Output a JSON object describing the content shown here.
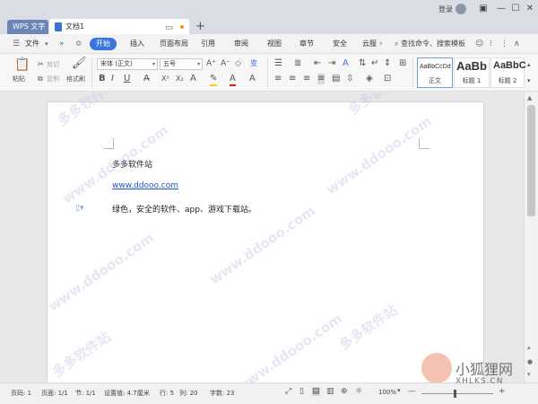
{
  "titlebar": {
    "app_tab": "WPS 文字",
    "doc_tab": "文档1",
    "new_tab": "+",
    "login": "登录",
    "minimize": "—",
    "maximize": "☐",
    "close": "✕"
  },
  "menu": {
    "file": "文件",
    "active": "开始",
    "items": [
      "插入",
      "页面布局",
      "引用",
      "审阅",
      "视图",
      "章节",
      "安全",
      "云服"
    ],
    "search": "查找命令、搜索模板"
  },
  "ribbon": {
    "paste": "粘贴",
    "cut": "剪切",
    "copy": "复制",
    "format_painter": "格式刷",
    "font": "宋体 (正文)",
    "size": "五号",
    "styles": [
      {
        "sample": "AaBbCcDd",
        "name": "正文"
      },
      {
        "sample": "AaBb",
        "name": "标题 1"
      },
      {
        "sample": "AaBbC",
        "name": "标题 2"
      }
    ],
    "colors": {
      "accent": "#3a74db",
      "font_color": "#e02020",
      "highlight": "#f5d020"
    }
  },
  "document": {
    "line1": "多多软件站",
    "line2": "www.ddooo.com",
    "line3": "绿色，安全的软件、app、游戏下载站。",
    "watermark_cn": "多多软件站",
    "watermark_url": "www.ddooo.com"
  },
  "statusbar": {
    "page": "页码: 1",
    "pages": "页面: 1/1",
    "section": "节: 1/1",
    "setting": "设置值: 4.7厘米",
    "row": "行: 5",
    "col": "列: 20",
    "words": "字数: 23",
    "zoom": "100%",
    "zoom_minus": "—",
    "zoom_plus": "+"
  },
  "branding": {
    "name": "小狐狸网",
    "url": "XHLKS.CN"
  }
}
